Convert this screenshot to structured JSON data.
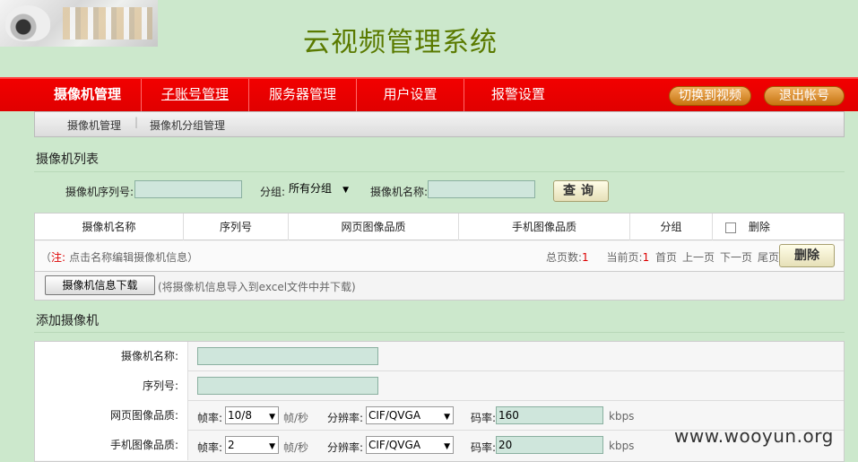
{
  "header": {
    "system_title": "云视频管理系统"
  },
  "nav": {
    "items": [
      "摄像机管理",
      "子账号管理",
      "服务器管理",
      "用户设置",
      "报警设置"
    ],
    "switch_video": "切换到视频",
    "logout": "退出帐号"
  },
  "subnav": {
    "items": [
      "摄像机管理",
      "摄像机分组管理"
    ],
    "separator": "|"
  },
  "camera_list": {
    "title": "摄像机列表",
    "serial_label": "摄像机序列号:",
    "serial_value": "",
    "group_label": "分组:",
    "group_value": "所有分组",
    "name_label": "摄像机名称:",
    "name_value": "",
    "query_button": "查询"
  },
  "table": {
    "columns": [
      "摄像机名称",
      "序列号",
      "网页图像品质",
      "手机图像品质",
      "分组",
      "删除"
    ],
    "note_prefix": "（",
    "note_label": "注:",
    "note_text": "点击名称编辑摄像机信息）",
    "total_pages_label": "总页数:",
    "total_pages": "1",
    "current_page_label": "当前页:",
    "current_page": "1",
    "first": "首页",
    "prev": "上一页",
    "next": "下一页",
    "last": "尾页",
    "delete_button": "删除"
  },
  "download": {
    "button": "摄像机信息下载",
    "hint": "(将摄像机信息导入到excel文件中并下载)"
  },
  "add_camera": {
    "title": "添加摄像机",
    "name_label": "摄像机名称:",
    "name_value": "",
    "serial_label": "序列号:",
    "serial_value": "",
    "web_quality_label": "网页图像品质:",
    "mobile_quality_label": "手机图像品质:",
    "fps_label": "帧率:",
    "fps_unit": "帧/秒",
    "resolution_label": "分辨率:",
    "bitrate_label": "码率:",
    "bitrate_unit": "kbps",
    "web": {
      "fps": "10/8",
      "resolution": "CIF/QVGA",
      "bitrate": "160"
    },
    "mobile": {
      "fps": "2",
      "resolution": "CIF/QVGA",
      "bitrate": "20"
    }
  },
  "watermark": "www.wooyun.org"
}
